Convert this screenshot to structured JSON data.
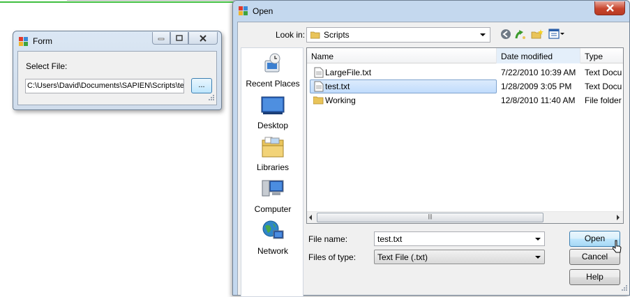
{
  "form_window": {
    "title": "Form",
    "select_file_label": "Select File:",
    "path_value": "C:\\Users\\David\\Documents\\SAPIEN\\Scripts\\test.txt",
    "browse_label": "..."
  },
  "open_dialog": {
    "title": "Open",
    "look_in_label": "Look in:",
    "look_in_value": "Scripts",
    "places": [
      {
        "label": "Recent Places",
        "icon": "recent-places-icon"
      },
      {
        "label": "Desktop",
        "icon": "desktop-icon"
      },
      {
        "label": "Libraries",
        "icon": "libraries-icon"
      },
      {
        "label": "Computer",
        "icon": "computer-icon"
      },
      {
        "label": "Network",
        "icon": "network-icon"
      }
    ],
    "columns": {
      "name": "Name",
      "date": "Date modified",
      "type": "Type"
    },
    "files": [
      {
        "name": "LargeFile.txt",
        "date": "7/22/2010 10:39 AM",
        "type": "Text Docu",
        "icon": "text-file-icon"
      },
      {
        "name": "test.txt",
        "date": "1/28/2009 3:05 PM",
        "type": "Text Docu",
        "icon": "text-file-icon",
        "selected": true
      },
      {
        "name": "Working",
        "date": "12/8/2010 11:40 AM",
        "type": "File folder",
        "icon": "folder-icon"
      }
    ],
    "scroll_thumb_glyph": "|||",
    "file_name_label": "File name:",
    "file_name_value": "test.txt",
    "files_of_type_label": "Files of type:",
    "files_of_type_value": "Text File (.txt)",
    "buttons": {
      "open": "Open",
      "cancel": "Cancel",
      "help": "Help"
    }
  },
  "colors": {
    "title_bar": "#c4d8ee",
    "selection": "#c1dcfc",
    "close_button": "#c7452d",
    "accent_line": "#3fbf3f"
  }
}
